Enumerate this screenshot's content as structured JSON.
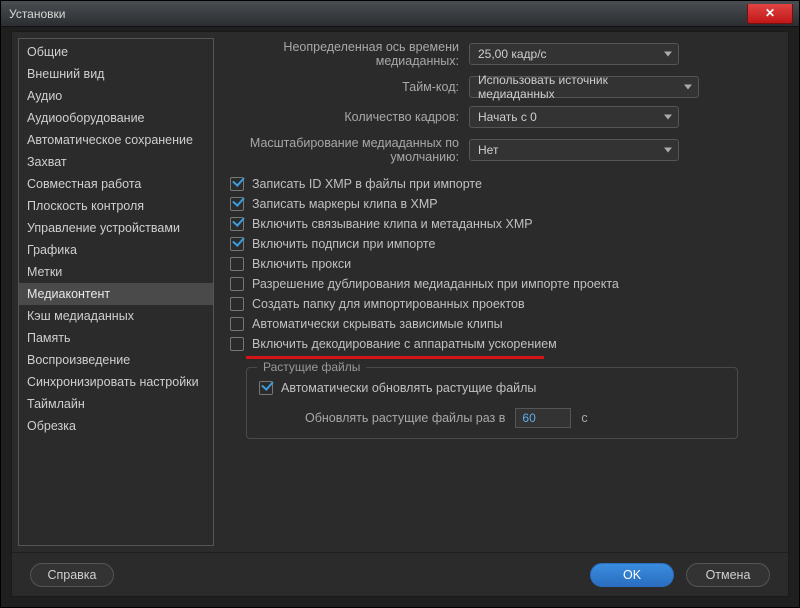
{
  "window": {
    "title": "Установки"
  },
  "sidebar": {
    "items": [
      {
        "label": "Общие"
      },
      {
        "label": "Внешний вид"
      },
      {
        "label": "Аудио"
      },
      {
        "label": "Аудиооборудование"
      },
      {
        "label": "Автоматическое сохранение"
      },
      {
        "label": "Захват"
      },
      {
        "label": "Совместная работа"
      },
      {
        "label": "Плоскость контроля"
      },
      {
        "label": "Управление устройствами"
      },
      {
        "label": "Графика"
      },
      {
        "label": "Метки"
      },
      {
        "label": "Медиаконтент",
        "selected": true
      },
      {
        "label": "Кэш медиаданных"
      },
      {
        "label": "Память"
      },
      {
        "label": "Воспроизведение"
      },
      {
        "label": "Синхронизировать настройки"
      },
      {
        "label": "Таймлайн"
      },
      {
        "label": "Обрезка"
      }
    ]
  },
  "fields": {
    "timebase": {
      "label": "Неопределенная ось времени медиаданных:",
      "value": "25,00 кадр/с"
    },
    "timecode": {
      "label": "Тайм-код:",
      "value": "Использовать источник медиаданных"
    },
    "framecount": {
      "label": "Количество кадров:",
      "value": "Начать с 0"
    },
    "defaultscale": {
      "label": "Масштабирование медиаданных по умолчанию:",
      "value": "Нет"
    }
  },
  "checks": [
    {
      "label": "Записать ID XMP в файлы при импорте",
      "checked": true
    },
    {
      "label": "Записать маркеры клипа в XMP",
      "checked": true
    },
    {
      "label": "Включить связывание клипа и метаданных XMP",
      "checked": true
    },
    {
      "label": "Включить подписи при импорте",
      "checked": true
    },
    {
      "label": "Включить прокси",
      "checked": false
    },
    {
      "label": "Разрешение дублирования медиаданных при импорте проекта",
      "checked": false
    },
    {
      "label": "Создать папку для импортированных проектов",
      "checked": false
    },
    {
      "label": "Автоматически скрывать зависимые клипы",
      "checked": false
    },
    {
      "label": "Включить декодирование с аппаратным ускорением",
      "checked": false
    }
  ],
  "growing": {
    "legend": "Растущие файлы",
    "auto_label": "Автоматически обновлять растущие файлы",
    "refresh_label": "Обновлять растущие файлы раз в",
    "value": "60",
    "unit": "с"
  },
  "footer": {
    "help": "Справка",
    "ok": "OK",
    "cancel": "Отмена"
  }
}
